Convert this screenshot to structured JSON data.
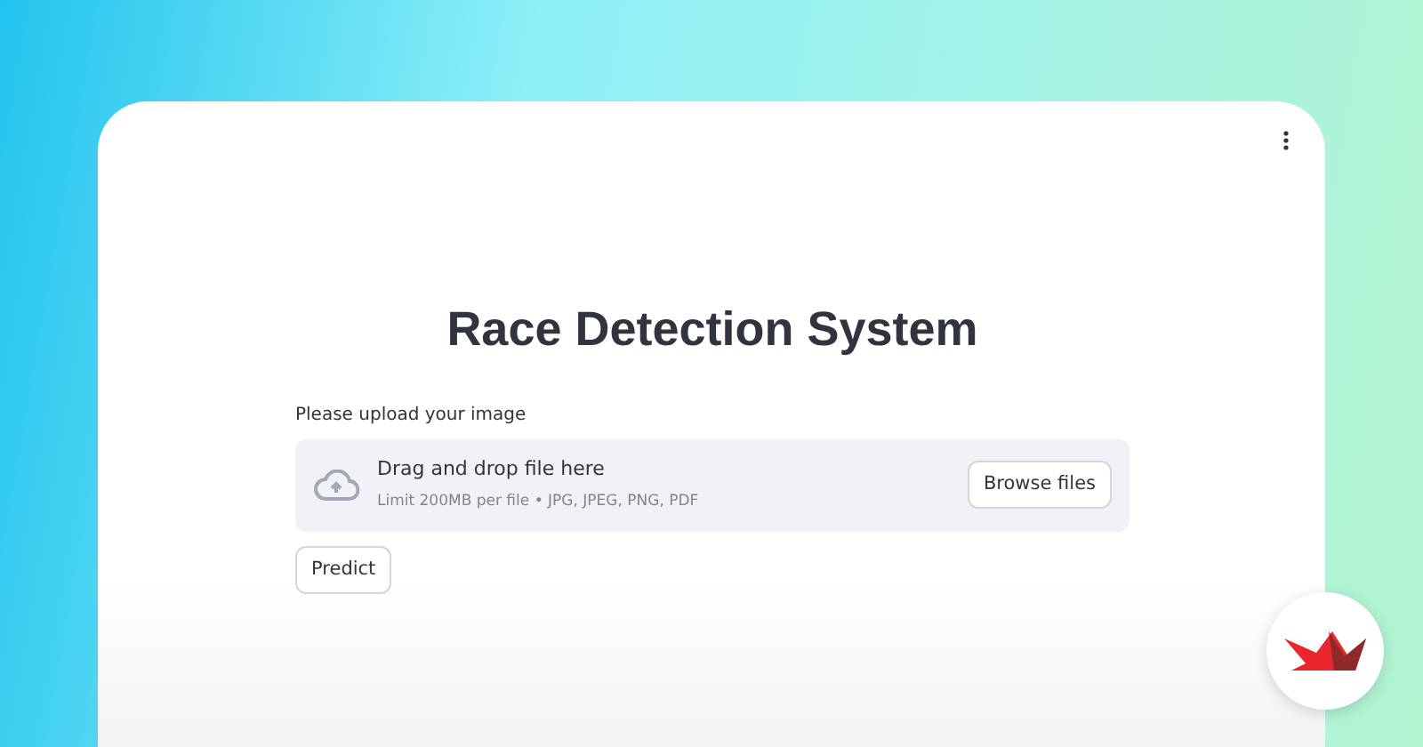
{
  "title": "Race Detection System",
  "uploader": {
    "label": "Please upload your image",
    "drop_text": "Drag and drop file here",
    "limit_text": "Limit 200MB per file • JPG, JPEG, PNG, PDF",
    "browse_button": "Browse files"
  },
  "predict_button": "Predict"
}
